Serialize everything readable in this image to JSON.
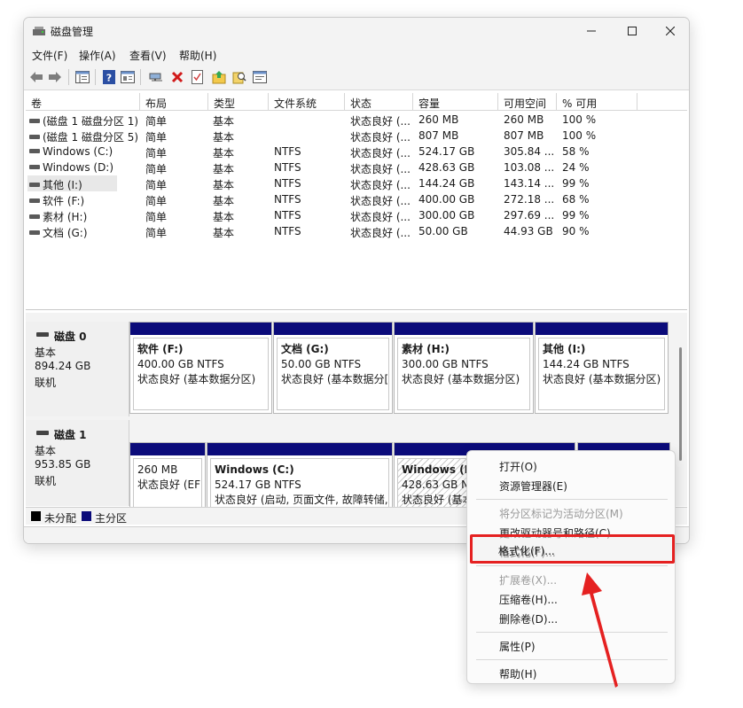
{
  "window": {
    "title": "磁盘管理",
    "minimize_icon": "minimize-icon",
    "maximize_icon": "maximize-icon",
    "close_icon": "close-icon"
  },
  "menu": [
    "文件(F)",
    "操作(A)",
    "查看(V)",
    "帮助(H)"
  ],
  "toolbar_icons": [
    "back-arrow-icon",
    "forward-arrow-icon",
    "properties-panel-icon",
    "help-icon",
    "view-panel-icon",
    "connect-icon",
    "delete-icon",
    "checklist-icon",
    "folder-up-icon",
    "search-doc-icon",
    "settings-window-icon"
  ],
  "columns": [
    "卷",
    "布局",
    "类型",
    "文件系统",
    "状态",
    "容量",
    "可用空间",
    "% 可用"
  ],
  "volumes": [
    {
      "name": "(磁盘 1 磁盘分区 1)",
      "layout": "简单",
      "type": "基本",
      "fs": "",
      "status": "状态良好 (...",
      "capacity": "260 MB",
      "free": "260 MB",
      "pct": "100 %"
    },
    {
      "name": "(磁盘 1 磁盘分区 5)",
      "layout": "简单",
      "type": "基本",
      "fs": "",
      "status": "状态良好 (...",
      "capacity": "807 MB",
      "free": "807 MB",
      "pct": "100 %"
    },
    {
      "name": "Windows (C:)",
      "layout": "简单",
      "type": "基本",
      "fs": "NTFS",
      "status": "状态良好 (...",
      "capacity": "524.17 GB",
      "free": "305.84 ...",
      "pct": "58 %"
    },
    {
      "name": "Windows (D:)",
      "layout": "简单",
      "type": "基本",
      "fs": "NTFS",
      "status": "状态良好 (...",
      "capacity": "428.63 GB",
      "free": "103.08 ...",
      "pct": "24 %"
    },
    {
      "name": "其他 (I:)",
      "layout": "简单",
      "type": "基本",
      "fs": "NTFS",
      "status": "状态良好 (...",
      "capacity": "144.24 GB",
      "free": "143.14 ...",
      "pct": "99 %"
    },
    {
      "name": "软件 (F:)",
      "layout": "简单",
      "type": "基本",
      "fs": "NTFS",
      "status": "状态良好 (...",
      "capacity": "400.00 GB",
      "free": "272.18 ...",
      "pct": "68 %"
    },
    {
      "name": "素材 (H:)",
      "layout": "简单",
      "type": "基本",
      "fs": "NTFS",
      "status": "状态良好 (...",
      "capacity": "300.00 GB",
      "free": "297.69 ...",
      "pct": "99 %"
    },
    {
      "name": "文档 (G:)",
      "layout": "简单",
      "type": "基本",
      "fs": "NTFS",
      "status": "状态良好 (...",
      "capacity": "50.00 GB",
      "free": "44.93 GB",
      "pct": "90 %"
    }
  ],
  "disks": [
    {
      "name": "磁盘 0",
      "type": "基本",
      "size": "894.24 GB",
      "state": "联机",
      "partitions": [
        {
          "title": "软件 (F:)",
          "size": "400.00 GB NTFS",
          "status": "状态良好 (基本数据分区)"
        },
        {
          "title": "文档 (G:)",
          "size": "50.00 GB NTFS",
          "status": "状态良好 (基本数据分[:"
        },
        {
          "title": "素材 (H:)",
          "size": "300.00 GB NTFS",
          "status": "状态良好 (基本数据分区)"
        },
        {
          "title": "其他 (I:)",
          "size": "144.24 GB NTFS",
          "status": "状态良好 (基本数据分区)"
        }
      ]
    },
    {
      "name": "磁盘 1",
      "type": "基本",
      "size": "953.85 GB",
      "state": "联机",
      "partitions": [
        {
          "title": "",
          "size": "260 MB",
          "status": "状态良好 (EFI"
        },
        {
          "title": "Windows (C:)",
          "size": "524.17 GB NTFS",
          "status": "状态良好 (启动, 页面文件, 故障转储,"
        },
        {
          "title": "Windows (D:)",
          "size": "428.63 GB NTFS",
          "status": "状态良好 (基本"
        },
        {
          "title": "",
          "size": "",
          "status": ""
        }
      ]
    }
  ],
  "legend": [
    {
      "label": "未分配",
      "color": "#000000"
    },
    {
      "label": "主分区",
      "color": "#0b0b7a"
    }
  ],
  "context_menu": {
    "items": [
      {
        "label": "打开(O)",
        "disabled": false
      },
      {
        "label": "资源管理器(E)",
        "disabled": false
      },
      {
        "label": "将分区标记为活动分区(M)",
        "disabled": true
      },
      {
        "label": "更改驱动器号和路径(C)...",
        "disabled": false
      },
      {
        "label": "格式化(F)...",
        "disabled": false
      },
      {
        "label": "扩展卷(X)...",
        "disabled": true
      },
      {
        "label": "压缩卷(H)...",
        "disabled": false
      },
      {
        "label": "删除卷(D)...",
        "disabled": false
      },
      {
        "label": "属性(P)",
        "disabled": false
      },
      {
        "label": "帮助(H)",
        "disabled": false
      }
    ]
  },
  "annotation": {
    "highlight_color": "#e52121"
  }
}
